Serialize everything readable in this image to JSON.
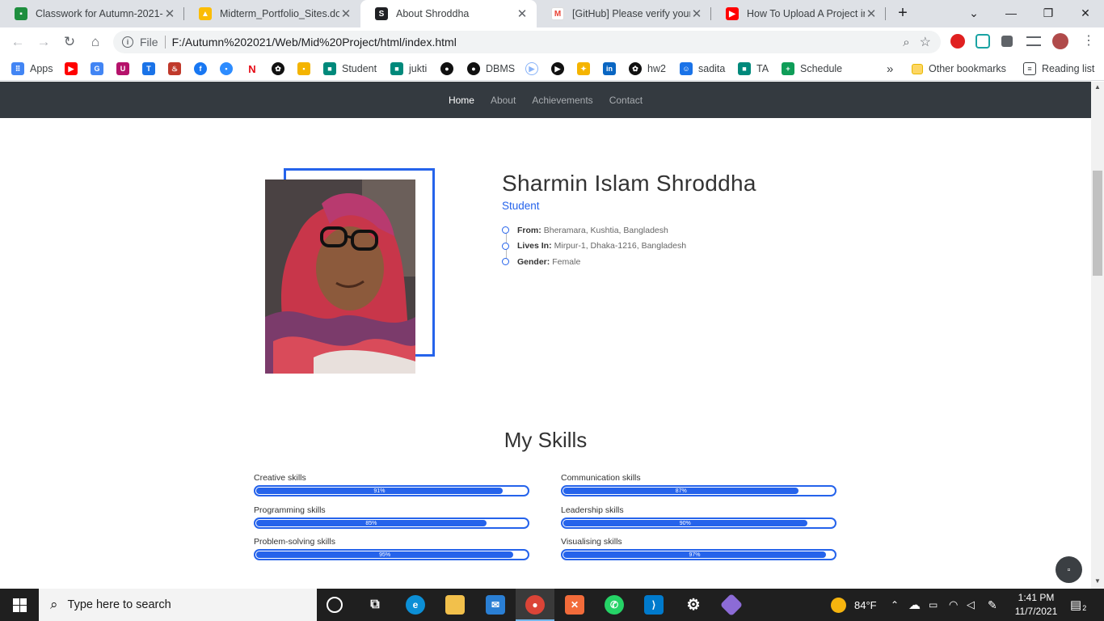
{
  "browser": {
    "tabs": [
      {
        "title": "Classwork for Autumn-2021-",
        "icon": "google-classroom-icon",
        "color": "#1e8e3e"
      },
      {
        "title": "Midterm_Portfolio_Sites.docx",
        "icon": "google-drive-icon",
        "color": "#fbbc04"
      },
      {
        "title": "About Shroddha",
        "icon": "site-s-icon",
        "color": "#202124",
        "active": true
      },
      {
        "title": "[GitHub] Please verify your d",
        "icon": "gmail-icon",
        "color": "#ea4335"
      },
      {
        "title": "How To Upload A Project in G",
        "icon": "youtube-icon",
        "color": "#ff0000"
      }
    ],
    "new_tab": "+",
    "window_controls": {
      "list": "⌄",
      "minimize": "—",
      "maximize": "❐",
      "close": "✕"
    },
    "address": {
      "scheme": "File",
      "url": "F:/Autumn%202021/Web/Mid%20Project/html/index.html"
    },
    "bookmarks": [
      {
        "label": "Apps",
        "icon": "apps-grid-icon",
        "color": "#4285f4"
      },
      {
        "label": "",
        "icon": "youtube-icon",
        "color": "#ff0000"
      },
      {
        "label": "",
        "icon": "google-translate-icon",
        "color": "#4285f4"
      },
      {
        "label": "",
        "icon": "uva-icon",
        "color": "#b5126b"
      },
      {
        "label": "",
        "icon": "typing-icon",
        "color": "#1a73e8"
      },
      {
        "label": "",
        "icon": "chef-icon",
        "color": "#c0392b"
      },
      {
        "label": "",
        "icon": "facebook-icon",
        "color": "#1877f2"
      },
      {
        "label": "",
        "icon": "zoom-icon",
        "color": "#2d8cff"
      },
      {
        "label": "",
        "icon": "netflix-icon",
        "color": "#e50914"
      },
      {
        "label": "",
        "icon": "openai-icon",
        "color": "#111111"
      },
      {
        "label": "",
        "icon": "drive-icon",
        "color": "#f4b400"
      },
      {
        "label": "Student",
        "icon": "meet-icon",
        "color": "#00897b"
      },
      {
        "label": "jukti",
        "icon": "meet-icon",
        "color": "#00897b"
      },
      {
        "label": "",
        "icon": "github-icon",
        "color": "#111111"
      },
      {
        "label": "DBMS",
        "icon": "github-icon",
        "color": "#111111"
      },
      {
        "label": "",
        "icon": "circle-play-icon",
        "color": "#8ab4f8"
      },
      {
        "label": "",
        "icon": "play-icon",
        "color": "#111111"
      },
      {
        "label": "",
        "icon": "puzzle-icon",
        "color": "#f5b400"
      },
      {
        "label": "",
        "icon": "linkedin-icon",
        "color": "#0a66c2"
      },
      {
        "label": "hw2",
        "icon": "openai-icon",
        "color": "#111111"
      },
      {
        "label": "sadita",
        "icon": "contact-icon",
        "color": "#1a73e8"
      },
      {
        "label": "TA",
        "icon": "meet-icon",
        "color": "#00897b"
      },
      {
        "label": "Schedule",
        "icon": "sheets-icon",
        "color": "#0f9d58"
      }
    ],
    "bookmarks_more": "»",
    "other_bookmarks": "Other bookmarks",
    "reading_list": "Reading list"
  },
  "site": {
    "nav": [
      {
        "label": "Home",
        "active": true
      },
      {
        "label": "About"
      },
      {
        "label": "Achievements"
      },
      {
        "label": "Contact"
      }
    ],
    "profile": {
      "name": "Sharmin Islam Shroddha",
      "role": "Student",
      "details": [
        {
          "key": "From:",
          "value": "Bheramara, Kushtia, Bangladesh"
        },
        {
          "key": "Lives In:",
          "value": "Mirpur-1, Dhaka-1216, Bangladesh"
        },
        {
          "key": "Gender:",
          "value": "Female"
        }
      ]
    },
    "skills_title": "My Skills",
    "skills": [
      {
        "label": "Creative skills",
        "percent": 91,
        "text": "91%"
      },
      {
        "label": "Communication skills",
        "percent": 87,
        "text": "87%"
      },
      {
        "label": "Programming skills",
        "percent": 85,
        "text": "85%"
      },
      {
        "label": "Leadership skills",
        "percent": 90,
        "text": "90%"
      },
      {
        "label": "Problem-solving skills",
        "percent": 95,
        "text": "95%"
      },
      {
        "label": "Visualising skills",
        "percent": 97,
        "text": "97%"
      }
    ],
    "accent": "#2563eb"
  },
  "taskbar": {
    "search_placeholder": "Type here to search",
    "weather": "84°F",
    "time": "1:41 PM",
    "date": "11/7/2021",
    "notifications": "2"
  }
}
